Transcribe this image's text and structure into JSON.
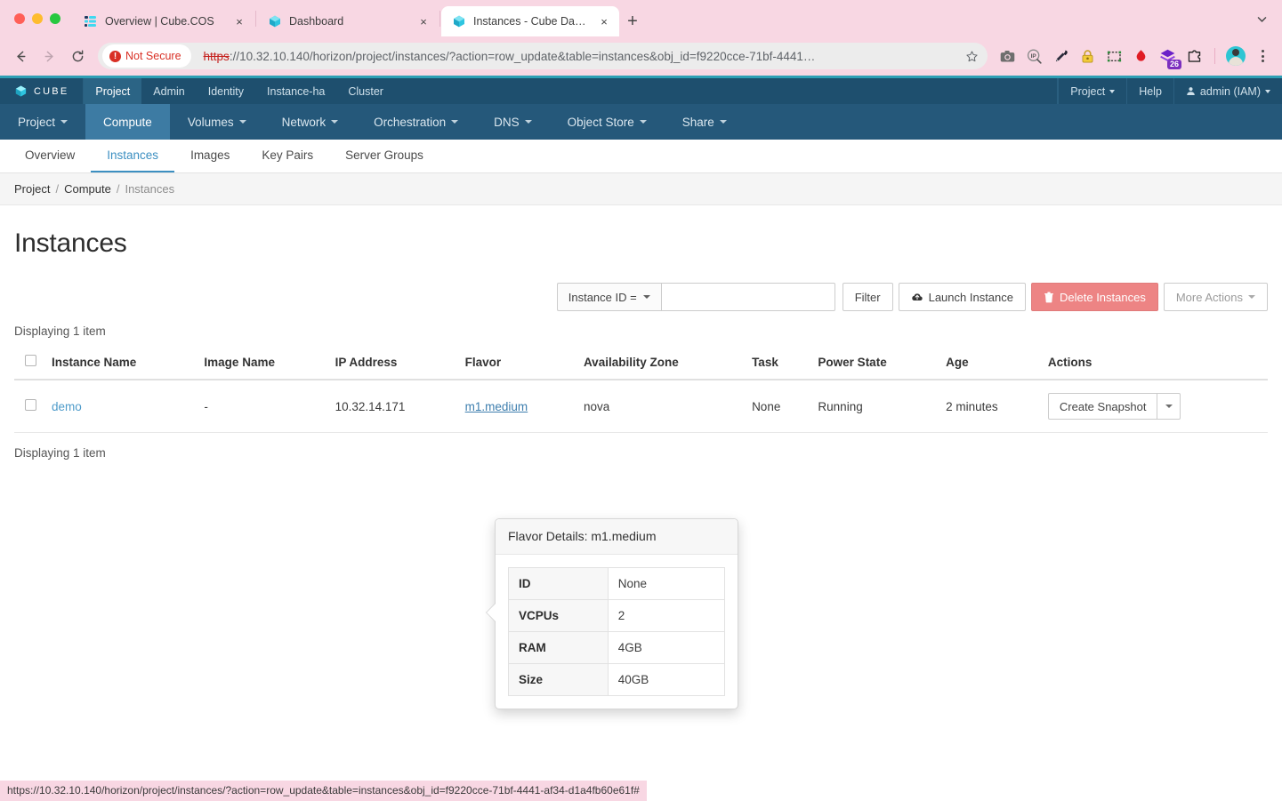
{
  "browser": {
    "tabs": [
      {
        "title": "Overview | Cube.COS",
        "favicon": "cube-cos-icon",
        "active": false,
        "close_label": "×"
      },
      {
        "title": "Dashboard",
        "favicon": "cube-icon",
        "active": false,
        "close_label": "×"
      },
      {
        "title": "Instances - Cube Dashboard",
        "favicon": "cube-icon",
        "active": true,
        "close_label": "×"
      }
    ],
    "new_tab_label": "+",
    "security_label": "Not Secure",
    "url": {
      "scheme": "https",
      "rest": "://10.32.10.140/horizon/project/instances/?action=row_update&table=instances&obj_id=f9220cce-71bf-4441…",
      "host": "10.32.10.140"
    },
    "extensions": [
      "camera-icon",
      "ip-search-icon",
      "eyedropper-icon",
      "lock-icon",
      "selection-frame-icon",
      "opera-drop-icon",
      "layers-icon",
      "puzzle-extension-icon"
    ],
    "extension_badge": "26",
    "profile": "avatar",
    "menu": "kebab-menu-icon"
  },
  "horizon": {
    "brand": "CUBE",
    "top_nav": [
      {
        "label": "Project",
        "active": true
      },
      {
        "label": "Admin",
        "active": false
      },
      {
        "label": "Identity",
        "active": false
      },
      {
        "label": "Instance-ha",
        "active": false
      },
      {
        "label": "Cluster",
        "active": false
      }
    ],
    "top_nav_right": [
      {
        "label": "Project",
        "caret": true
      },
      {
        "label": "Help",
        "caret": false
      },
      {
        "label": "admin (IAM)",
        "caret": true
      }
    ],
    "menu_bar": [
      {
        "label": "Project",
        "caret": true,
        "active": false
      },
      {
        "label": "Compute",
        "caret": false,
        "active": true
      },
      {
        "label": "Volumes",
        "caret": true,
        "active": false
      },
      {
        "label": "Network",
        "caret": true,
        "active": false
      },
      {
        "label": "Orchestration",
        "caret": true,
        "active": false
      },
      {
        "label": "DNS",
        "caret": true,
        "active": false
      },
      {
        "label": "Object Store",
        "caret": true,
        "active": false
      },
      {
        "label": "Share",
        "caret": true,
        "active": false
      }
    ],
    "tabs": [
      {
        "label": "Overview",
        "active": false
      },
      {
        "label": "Instances",
        "active": true
      },
      {
        "label": "Images",
        "active": false
      },
      {
        "label": "Key Pairs",
        "active": false
      },
      {
        "label": "Server Groups",
        "active": false
      }
    ],
    "breadcrumb": [
      "Project",
      "Compute",
      "Instances"
    ],
    "breadcrumb_separator": "/"
  },
  "page": {
    "title": "Instances",
    "displaying_top": "Displaying 1 item",
    "displaying_bottom": "Displaying 1 item"
  },
  "toolbar": {
    "filter_select": "Instance ID =",
    "filter_input_value": "",
    "filter_input_placeholder": "",
    "filter_button": "Filter",
    "launch_instance": "Launch Instance",
    "launch_instance_icon": "cloud-upload-icon",
    "delete_instances": "Delete Instances",
    "delete_instances_icon": "trash-icon",
    "more_actions": "More Actions",
    "danger_color": "#ed8484"
  },
  "table": {
    "columns": [
      "Instance Name",
      "Image Name",
      "IP Address",
      "Flavor",
      "Availability Zone",
      "Task",
      "Power State",
      "Age",
      "Actions"
    ],
    "rows": [
      {
        "instance_name": "demo",
        "image_name": "-",
        "ip_address": "10.32.14.171",
        "flavor": "m1.medium",
        "availability_zone": "nova",
        "task": "None",
        "power_state": "Running",
        "age": "2 minutes",
        "action_primary": "Create Snapshot"
      }
    ]
  },
  "popover": {
    "title": "Flavor Details: m1.medium",
    "rows": [
      {
        "key": "ID",
        "value": "None"
      },
      {
        "key": "VCPUs",
        "value": "2"
      },
      {
        "key": "RAM",
        "value": "4GB"
      },
      {
        "key": "Size",
        "value": "40GB"
      }
    ]
  },
  "status_bar": {
    "url": "https://10.32.10.140/horizon/project/instances/?action=row_update&table=instances&obj_id=f9220cce-71bf-4441-af34-d1a4fb60e61f#"
  }
}
